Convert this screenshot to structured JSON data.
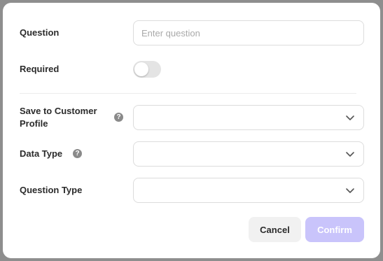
{
  "form": {
    "question_label": "Question",
    "question_placeholder": "Enter question",
    "question_value": "",
    "required_label": "Required",
    "required_on": false,
    "save_to_profile_label_line1": "Save to Customer",
    "save_to_profile_label_line2": "Profile",
    "save_to_profile_value": "",
    "data_type_label": "Data Type",
    "data_type_value": "",
    "question_type_label": "Question Type",
    "question_type_value": "",
    "help_glyph": "?"
  },
  "buttons": {
    "cancel_label": "Cancel",
    "confirm_label": "Confirm"
  },
  "colors": {
    "confirm_disabled_bg": "#c9c4fb",
    "toggle_off_bg": "#e4e4e4"
  },
  "icons": {
    "help": "help-icon",
    "chevron": "chevron-down-icon"
  }
}
